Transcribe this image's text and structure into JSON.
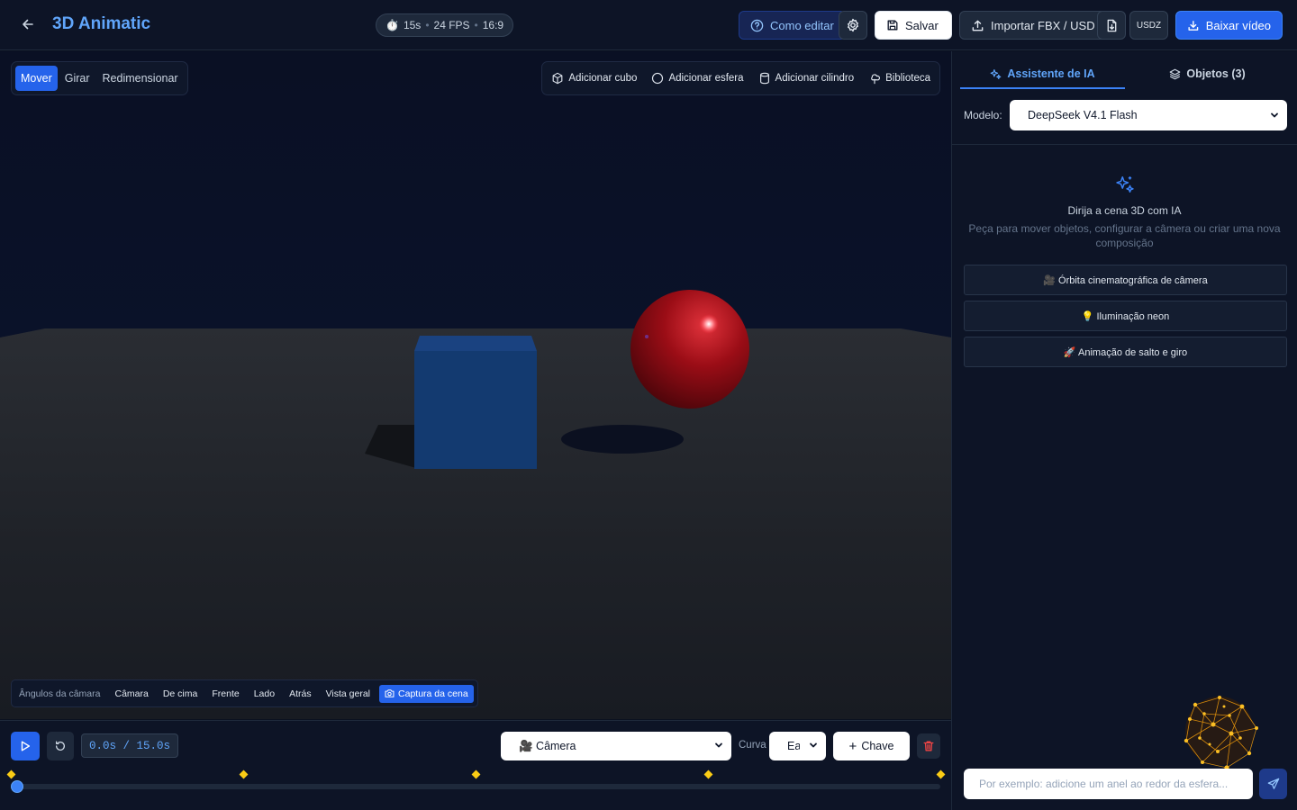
{
  "header": {
    "title": "3D Animatic",
    "meta": {
      "duration": "15s",
      "fps": "24 FPS",
      "aspect": "16:9",
      "separator": "•"
    },
    "help_label": "Como editar",
    "save_label": "Salvar",
    "import_label": "Importar FBX / USD",
    "usdz_label": "USDZ",
    "download_label": "Baixar vídeo"
  },
  "tools": {
    "move": "Mover",
    "rotate": "Girar",
    "resize": "Redimensionar",
    "active": "move"
  },
  "add_menu": {
    "cube": "Adicionar cubo",
    "sphere": "Adicionar esfera",
    "cylinder": "Adicionar cilindro",
    "library": "Biblioteca"
  },
  "camera_angles": {
    "label": "Ângulos da câmara",
    "items": [
      "Câmara",
      "De cima",
      "Frente",
      "Lado",
      "Atrás",
      "Vista geral"
    ],
    "capture": "Captura da cena"
  },
  "timeline": {
    "readout": "0.0s / 15.0s",
    "current_time": 0,
    "total_time": 15,
    "keyframes": [
      0,
      3.75,
      7.5,
      11.25,
      15
    ],
    "target": "🎥 Câmera",
    "curve_label": "Curva",
    "curve_value": "Ease",
    "key_label": "Chave"
  },
  "sidebar": {
    "tabs": {
      "assistant": "Assistente de IA",
      "objects": "Objetos (3)"
    },
    "model_label": "Modelo:",
    "model_value": "DeepSeek V4.1 Flash",
    "empty_title": "Dirija a cena 3D com IA",
    "empty_desc": "Peça para mover objetos, configurar a câmera ou criar uma nova composição",
    "suggestions": [
      "🎥 Órbita cinematográfica de câmera",
      "💡 Iluminação neon",
      "🚀 Animação de salto e giro"
    ],
    "input_placeholder": "Por exemplo: adicione um anel ao redor da esfera..."
  },
  "colors": {
    "accent": "#2563eb",
    "title": "#60a5fa",
    "cube": "#1e4f96",
    "sphere": "#9b0d16",
    "keyframe": "#facc15"
  }
}
